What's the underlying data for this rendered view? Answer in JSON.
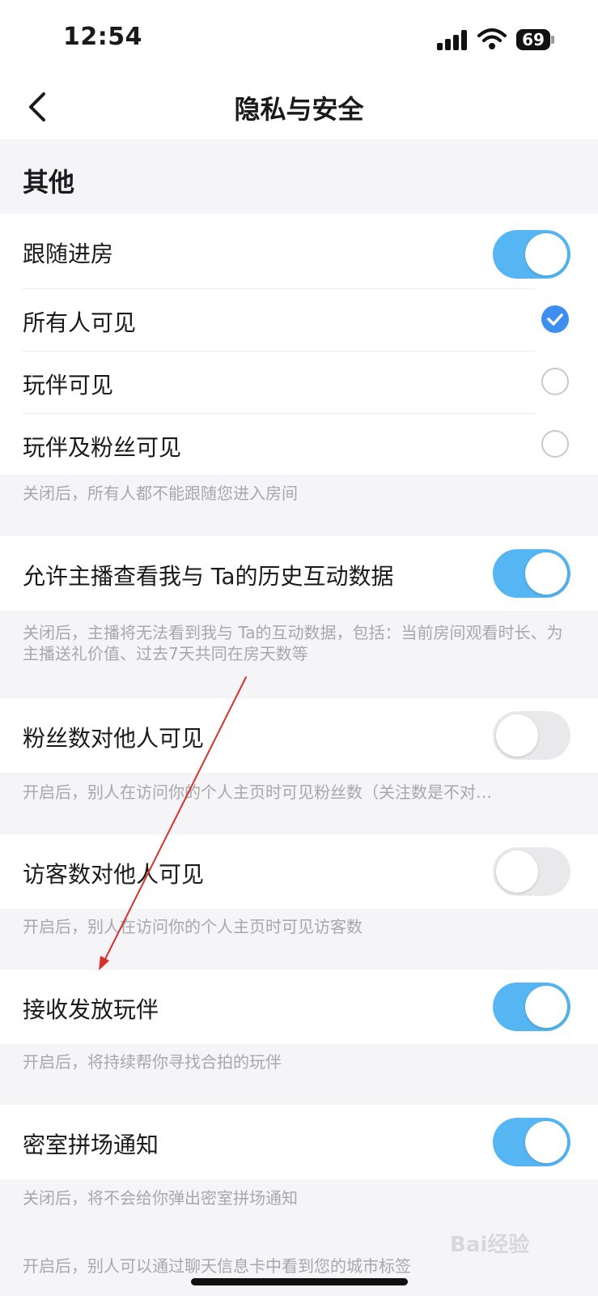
{
  "status_bar": {
    "time": "12:54",
    "battery": "69"
  },
  "nav": {
    "title": "隐私与安全"
  },
  "section": {
    "title": "其他"
  },
  "follow": {
    "label": "跟随进房",
    "toggle_on": true,
    "options": [
      {
        "label": "所有人可见",
        "checked": true
      },
      {
        "label": "玩伴可见",
        "checked": false
      },
      {
        "label": "玩伴及粉丝可见",
        "checked": false
      }
    ],
    "note": "关闭后，所有人都不能跟随您进入房间"
  },
  "history": {
    "label": "允许主播查看我与 Ta的历史互动数据",
    "toggle_on": true,
    "note": "关闭后，主播将无法看到我与 Ta的互动数据，包括：当前房间观看时长、为主播送礼价值、过去7天共同在房天数等"
  },
  "fans": {
    "label": "粉丝数对他人可见",
    "toggle_on": false,
    "note": "开启后，别人在访问你的个人主页时可见粉丝数（关注数是不对…"
  },
  "visitors": {
    "label": "访客数对他人可见",
    "toggle_on": false,
    "note": "开启后，别人在访问你的个人主页时可见访客数"
  },
  "partner": {
    "label": "接收发放玩伴",
    "toggle_on": true,
    "note": "开启后，将持续帮你寻找合拍的玩伴"
  },
  "escape_room": {
    "label": "密室拼场通知",
    "toggle_on": true,
    "note": "关闭后，将不会给你弹出密室拼场通知"
  },
  "city": {
    "note": "开启后，别人可以通过聊天信息卡中看到您的城市标签"
  },
  "icons": {
    "back": "chevron-left-icon",
    "check": "checkmark-icon",
    "signal": "cellular-signal-icon",
    "wifi": "wifi-icon",
    "battery": "battery-icon"
  },
  "colors": {
    "toggle_on": "#55b6f3",
    "toggle_off": "#e9e9ec",
    "radio_checked": "#3d8ef0",
    "annotation_arrow": "#d9302c"
  },
  "watermark": "Bai经验"
}
